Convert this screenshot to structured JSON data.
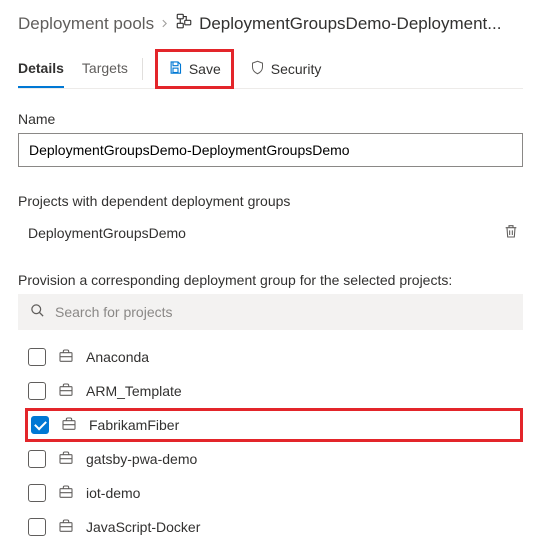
{
  "breadcrumb": {
    "root": "Deployment pools",
    "current": "DeploymentGroupsDemo-Deployment..."
  },
  "tabs": {
    "details": "Details",
    "targets": "Targets"
  },
  "toolbar": {
    "save": "Save",
    "security": "Security"
  },
  "nameSection": {
    "label": "Name",
    "value": "DeploymentGroupsDemo-DeploymentGroupsDemo"
  },
  "dependent": {
    "label": "Projects with dependent deployment groups",
    "items": [
      "DeploymentGroupsDemo"
    ]
  },
  "provision": {
    "label": "Provision a corresponding deployment group for the selected projects:",
    "searchPlaceholder": "Search for projects",
    "projects": [
      {
        "name": "Anaconda",
        "checked": false
      },
      {
        "name": "ARM_Template",
        "checked": false
      },
      {
        "name": "FabrikamFiber",
        "checked": true,
        "highlight": true
      },
      {
        "name": "gatsby-pwa-demo",
        "checked": false
      },
      {
        "name": "iot-demo",
        "checked": false
      },
      {
        "name": "JavaScript-Docker",
        "checked": false
      }
    ]
  }
}
